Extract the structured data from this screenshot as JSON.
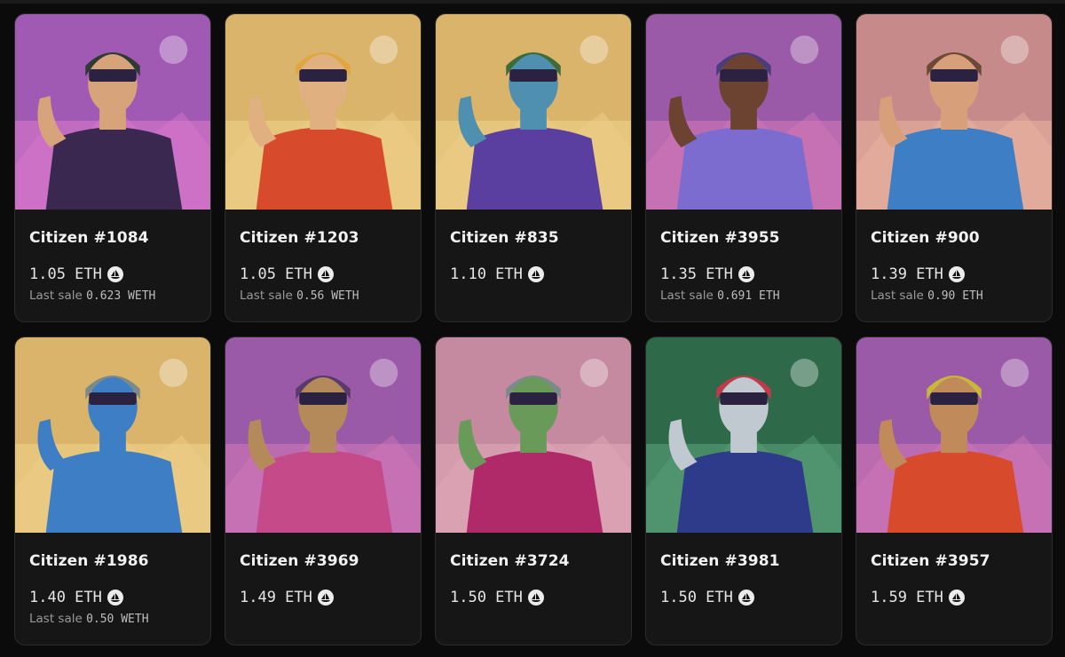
{
  "cards": [
    {
      "name": "Citizen #1084",
      "price": "1.05 ETH",
      "last_sale_label": "Last sale",
      "last_sale_value": "0.623 WETH",
      "bg": "#a05ab4",
      "bg2": "#d978c9",
      "shirt": "#3a2850",
      "skin": "#d7a37a",
      "helmet": "#2f3a33"
    },
    {
      "name": "Citizen #1203",
      "price": "1.05 ETH",
      "last_sale_label": "Last sale",
      "last_sale_value": "0.56 WETH",
      "bg": "#d9b46a",
      "bg2": "#efd08a",
      "shirt": "#d84a2c",
      "skin": "#e0b080",
      "helmet": "#e0a640"
    },
    {
      "name": "Citizen #835",
      "price": "1.10 ETH",
      "last_sale_label": "",
      "last_sale_value": "",
      "bg": "#d9b46a",
      "bg2": "#efd08a",
      "shirt": "#5a3ea0",
      "skin": "#4f8fb0",
      "helmet": "#3d6b3a"
    },
    {
      "name": "Citizen #3955",
      "price": "1.35 ETH",
      "last_sale_label": "Last sale",
      "last_sale_value": "0.691 ETH",
      "bg": "#9a5aa8",
      "bg2": "#d278b8",
      "shirt": "#7d6cd0",
      "skin": "#6b4330",
      "helmet": "#4a3d7a"
    },
    {
      "name": "Citizen #900",
      "price": "1.39 ETH",
      "last_sale_label": "Last sale",
      "last_sale_value": "0.90 ETH",
      "bg": "#c68a8a",
      "bg2": "#e8b3a0",
      "shirt": "#3d7ec4",
      "skin": "#d8a07a",
      "helmet": "#6b4a35"
    },
    {
      "name": "Citizen #1986",
      "price": "1.40 ETH",
      "last_sale_label": "Last sale",
      "last_sale_value": "0.50 WETH",
      "bg": "#d9b46a",
      "bg2": "#efd08a",
      "shirt": "#3d7ec4",
      "skin": "#3d7ec4",
      "helmet": "#7b8a8a"
    },
    {
      "name": "Citizen #3969",
      "price": "1.49 ETH",
      "last_sale_label": "",
      "last_sale_value": "",
      "bg": "#9a5aa8",
      "bg2": "#d278b8",
      "shirt": "#c44a8a",
      "skin": "#b58a5a",
      "helmet": "#5a3a6a"
    },
    {
      "name": "Citizen #3724",
      "price": "1.50 ETH",
      "last_sale_label": "",
      "last_sale_value": "",
      "bg": "#c68aa0",
      "bg2": "#e0a8b8",
      "shirt": "#b02a6a",
      "skin": "#6a9a5a",
      "helmet": "#7b8a8a"
    },
    {
      "name": "Citizen #3981",
      "price": "1.50 ETH",
      "last_sale_label": "",
      "last_sale_value": "",
      "bg": "#2e6a4a",
      "bg2": "#5aa07a",
      "shirt": "#2e3a8a",
      "skin": "#c0c8d0",
      "helmet": "#c03a4a"
    },
    {
      "name": "Citizen #3957",
      "price": "1.59 ETH",
      "last_sale_label": "",
      "last_sale_value": "",
      "bg": "#9a5aa8",
      "bg2": "#d278b8",
      "shirt": "#d84a2c",
      "skin": "#c08a5a",
      "helmet": "#c8b83a"
    }
  ]
}
